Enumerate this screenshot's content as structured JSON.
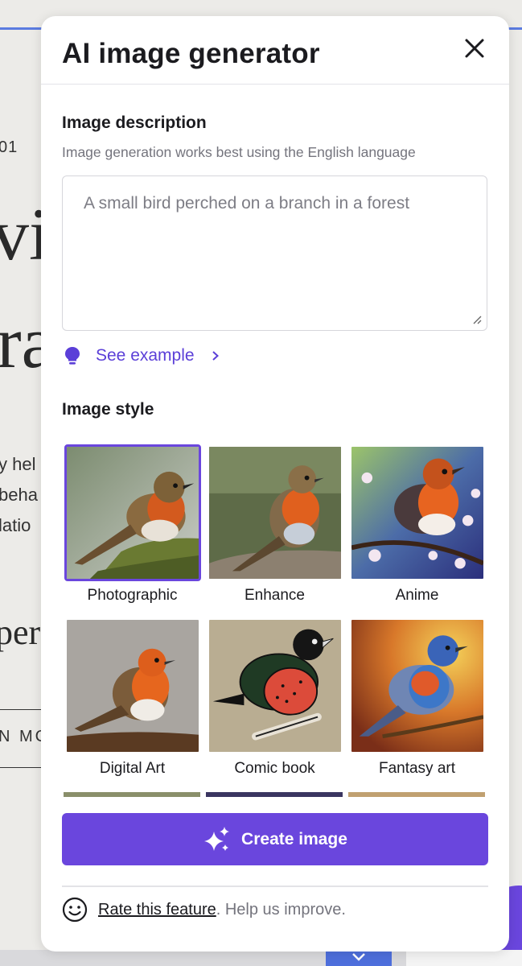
{
  "background_page": {
    "fragments": [
      "01",
      "vi",
      "ra",
      "y hel",
      "beha",
      "latio",
      "per",
      "N MC"
    ]
  },
  "panel": {
    "title": "AI image generator",
    "close_icon": "close-icon",
    "description": {
      "label": "Image description",
      "hint": "Image generation works best using the English language",
      "value": "",
      "placeholder": "A small bird perched on a branch in a forest"
    },
    "see_example": {
      "label": "See example",
      "icon": "lightbulb-icon"
    },
    "style": {
      "label": "Image style",
      "selected": "Photographic",
      "options": [
        {
          "label": "Photographic"
        },
        {
          "label": "Enhance"
        },
        {
          "label": "Anime"
        },
        {
          "label": "Digital Art"
        },
        {
          "label": "Comic book"
        },
        {
          "label": "Fantasy art"
        }
      ]
    },
    "create_button": {
      "label": "Create image",
      "icon": "sparkle-icon"
    },
    "footer": {
      "link_text": "Rate this feature",
      "text": ". Help us improve.",
      "icon": "smiley-icon"
    }
  },
  "colors": {
    "accent": "#6a46dd",
    "link": "#5b3fd8",
    "muted_text": "#74747d",
    "text": "#1b1b1f"
  }
}
